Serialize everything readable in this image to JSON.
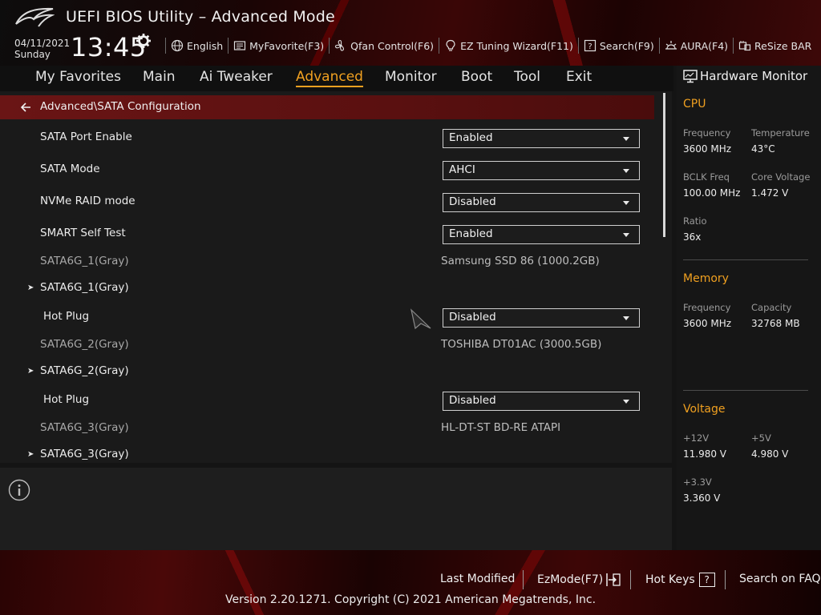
{
  "header": {
    "title": "UEFI BIOS Utility – Advanced Mode",
    "date": "04/11/2021",
    "day": "Sunday",
    "time": "13:45",
    "toolbar": [
      {
        "label": "English",
        "icon": "globe-icon"
      },
      {
        "label": "MyFavorite(F3)",
        "icon": "favorite-icon"
      },
      {
        "label": "Qfan Control(F6)",
        "icon": "fan-icon"
      },
      {
        "label": "EZ Tuning Wizard(F11)",
        "icon": "lightbulb-icon"
      },
      {
        "label": "Search(F9)",
        "icon": "search-help-icon"
      },
      {
        "label": "AURA(F4)",
        "icon": "aura-icon"
      },
      {
        "label": "ReSize BAR",
        "icon": "resize-bar-icon"
      }
    ]
  },
  "nav": {
    "tabs": [
      "My Favorites",
      "Main",
      "Ai Tweaker",
      "Advanced",
      "Monitor",
      "Boot",
      "Tool",
      "Exit"
    ],
    "active": "Advanced"
  },
  "breadcrumb": "Advanced\\SATA Configuration",
  "settings": {
    "sata_port_enable": {
      "label": "SATA Port Enable",
      "value": "Enabled"
    },
    "sata_mode": {
      "label": "SATA Mode",
      "value": "AHCI"
    },
    "nvme_raid": {
      "label": "NVMe RAID mode",
      "value": "Disabled"
    },
    "smart_self_test": {
      "label": "SMART Self Test",
      "value": "Enabled"
    },
    "sata6g_1_info": {
      "label": "SATA6G_1(Gray)",
      "value": "Samsung SSD 86 (1000.2GB)"
    },
    "sata6g_1_sub": {
      "label": "SATA6G_1(Gray)"
    },
    "hot_plug_1": {
      "label": "Hot Plug",
      "value": "Disabled"
    },
    "sata6g_2_info": {
      "label": "SATA6G_2(Gray)",
      "value": "TOSHIBA DT01AC (3000.5GB)"
    },
    "sata6g_2_sub": {
      "label": "SATA6G_2(Gray)"
    },
    "hot_plug_2": {
      "label": "Hot Plug",
      "value": "Disabled"
    },
    "sata6g_3_info": {
      "label": "SATA6G_3(Gray)",
      "value": "HL-DT-ST BD-RE ATAPI"
    },
    "sata6g_3_sub": {
      "label": "SATA6G_3(Gray)"
    }
  },
  "hw_monitor": {
    "title": "Hardware Monitor",
    "cpu": {
      "title": "CPU",
      "frequency_label": "Frequency",
      "frequency": "3600 MHz",
      "temperature_label": "Temperature",
      "temperature": "43°C",
      "bclk_label": "BCLK Freq",
      "bclk": "100.00 MHz",
      "core_voltage_label": "Core Voltage",
      "core_voltage": "1.472 V",
      "ratio_label": "Ratio",
      "ratio": "36x"
    },
    "memory": {
      "title": "Memory",
      "frequency_label": "Frequency",
      "frequency": "3600 MHz",
      "capacity_label": "Capacity",
      "capacity": "32768 MB"
    },
    "voltage": {
      "title": "Voltage",
      "v12_label": "+12V",
      "v12": "11.980 V",
      "v5_label": "+5V",
      "v5": "4.980 V",
      "v33_label": "+3.3V",
      "v33": "3.360 V"
    }
  },
  "footer": {
    "last_modified": "Last Modified",
    "ezmode": "EzMode(F7)",
    "hot_keys": "Hot Keys",
    "hot_keys_key": "?",
    "search_faq": "Search on FAQ",
    "copyright": "Version 2.20.1271. Copyright (C) 2021 American Megatrends, Inc."
  },
  "colors": {
    "accent": "#f0a020",
    "breadcrumb_bg": "#6a1515",
    "panel_bg": "#1a1a1a"
  }
}
